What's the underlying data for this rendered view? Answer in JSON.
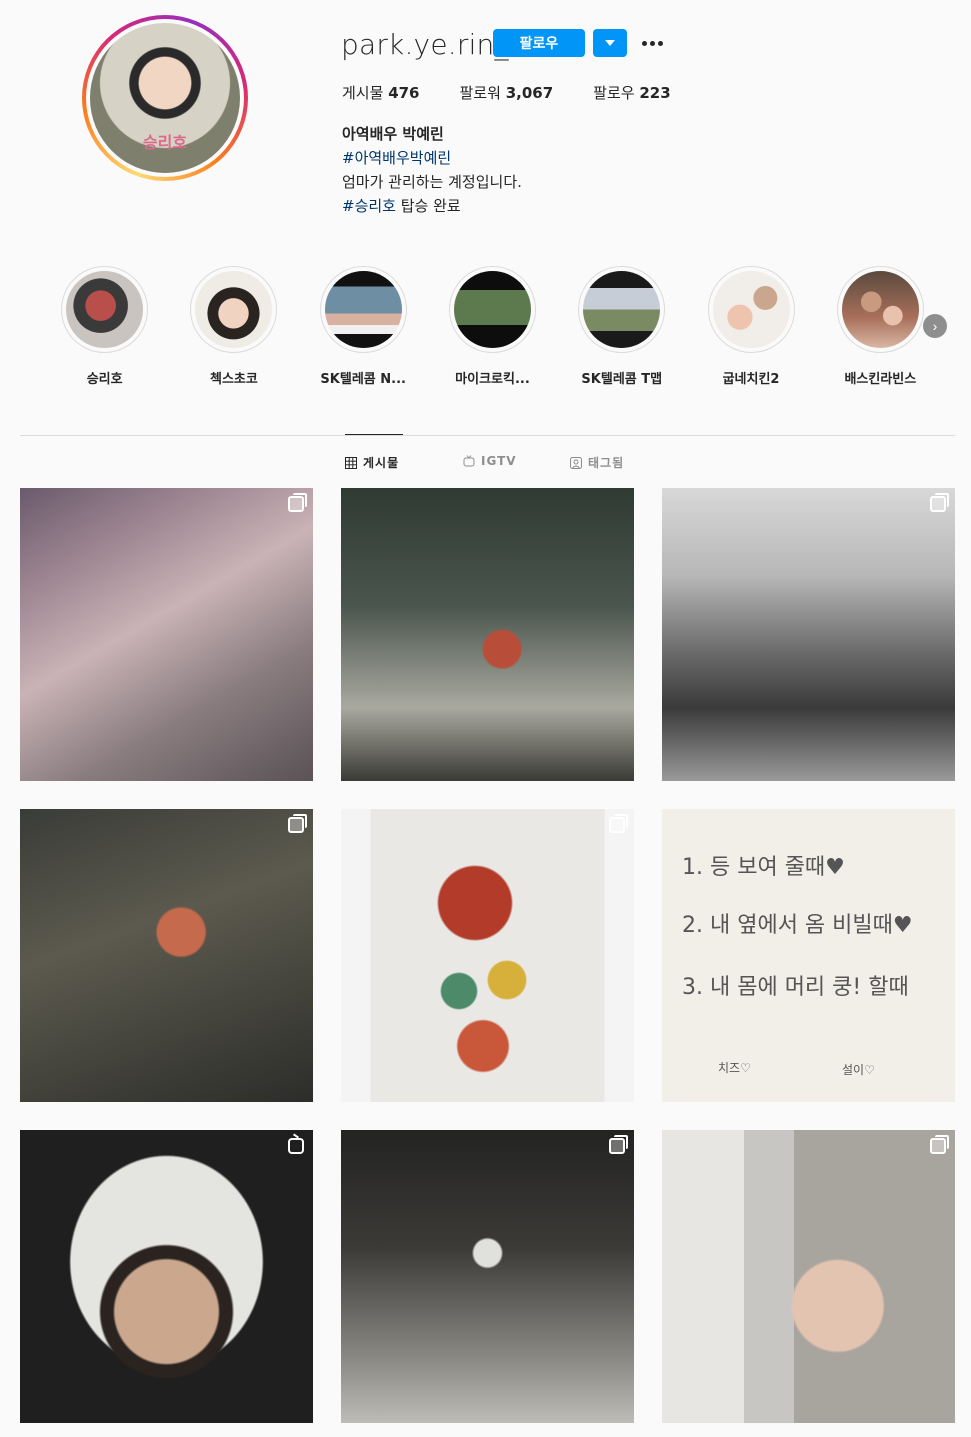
{
  "profile": {
    "username": "park.ye.rin_",
    "follow_label": "팔로우",
    "avatar_text": "승리호",
    "stats": [
      {
        "label": "게시물",
        "value": "476"
      },
      {
        "label": "팔로워",
        "value": "3,067"
      },
      {
        "label": "팔로우",
        "value": "223"
      }
    ],
    "bio": {
      "name": "아역배우 박예린",
      "hashtag1": "#아역배우박예린",
      "line2": "엄마가 관리하는 계정입니다.",
      "hashtag2": "#승리호",
      "line3": " 탑승 완료"
    },
    "link_color": "#00376b",
    "accent": "#0095f6"
  },
  "highlights": [
    {
      "label": "승리호"
    },
    {
      "label": "첵스초코"
    },
    {
      "label": "SK텔레콤 N..."
    },
    {
      "label": "마이크로킥..."
    },
    {
      "label": "SK텔레콤 T맵"
    },
    {
      "label": "굽네치킨2"
    },
    {
      "label": "배스킨라빈스"
    }
  ],
  "tabs": [
    {
      "label": "게시물",
      "icon": "grid-icon",
      "active": true
    },
    {
      "label": "IGTV",
      "icon": "igtv-icon",
      "active": false
    },
    {
      "label": "태그됨",
      "icon": "tag-icon",
      "active": false
    }
  ],
  "posts": [
    {
      "badge": "multi"
    },
    {
      "badge": "none"
    },
    {
      "badge": "multi"
    },
    {
      "badge": "multi"
    },
    {
      "badge": "multi"
    },
    {
      "badge": "none"
    },
    {
      "badge": "igtv"
    },
    {
      "badge": "multi"
    },
    {
      "badge": "multi"
    }
  ],
  "note_lines": [
    "1. 등 보여 줄때♥",
    "2. 내 옆에서 옴 비빌때♥",
    "3. 내 몸에 머리 쿵! 할때",
    "치즈♡",
    "설이♡"
  ]
}
